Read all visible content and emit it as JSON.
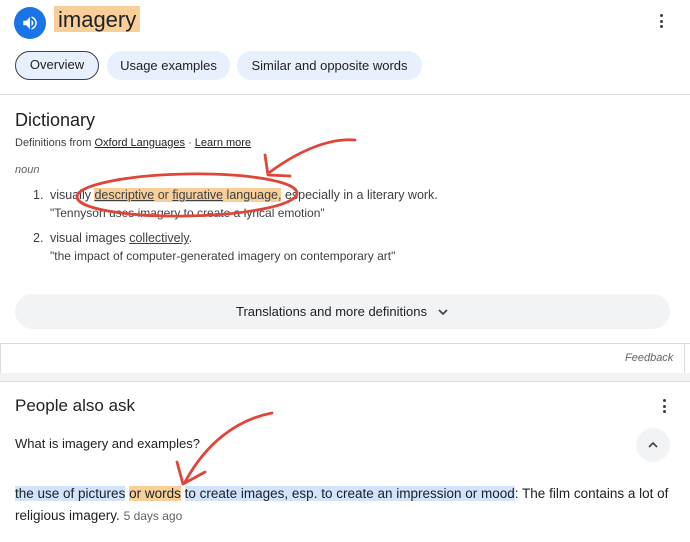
{
  "header": {
    "word": "imagery",
    "speaker_icon": "volume-icon",
    "more_icon": "more-vert-icon"
  },
  "tabs": [
    {
      "label": "Overview",
      "active": true
    },
    {
      "label": "Usage examples",
      "active": false
    },
    {
      "label": "Similar and opposite words",
      "active": false
    }
  ],
  "dictionary": {
    "title": "Dictionary",
    "source_prefix": "Definitions from",
    "source_link": "Oxford Languages",
    "separator": "·",
    "learn_more": "Learn more",
    "part_of_speech": "noun",
    "definitions": [
      {
        "number": "1.",
        "text_start": "visually",
        "link1": "descriptive",
        "joiner": "or",
        "link2": "figurative",
        "text_hl_end": "language,",
        "text_end": "especially in a literary work.",
        "example": "\"Tennyson uses imagery to create a lyrical emotion\""
      },
      {
        "number": "2.",
        "text_start": "visual images",
        "link": "collectively",
        "text_end": ".",
        "example": "\"the impact of computer-generated imagery on contemporary art\""
      }
    ],
    "translations_button": "Translations and more definitions",
    "feedback": "Feedback"
  },
  "people_also_ask": {
    "title": "People also ask",
    "question": "What is imagery and examples?",
    "answer_blue_1": "the use of pictures",
    "answer_orange": "or words",
    "answer_blue_2": "to create images, esp. to create an impression or mood",
    "answer_rest": ": The film contains a lot of religious imagery.",
    "answer_date": "5 days ago"
  },
  "colors": {
    "accent": "#1a73e8",
    "highlight_orange": "#f8cf99",
    "highlight_blue": "#d2e3fc",
    "annotation_red": "#e0453a"
  }
}
